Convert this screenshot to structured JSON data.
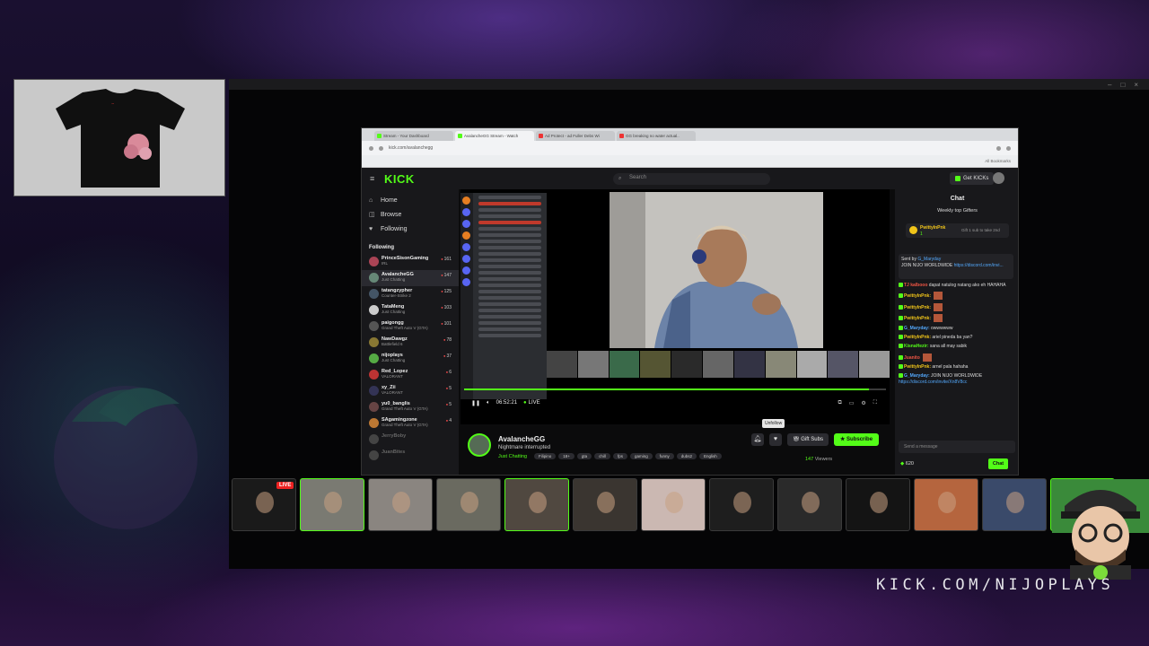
{
  "browser": {
    "tabs": [
      {
        "label": "Stream - Your Dashboard",
        "color": "#53fc18",
        "active": false
      },
      {
        "label": "AvalancheGG Stream - Watch",
        "color": "#53fc18",
        "active": true
      },
      {
        "label": "Ad Protect - ad Fuller Debs Wi",
        "color": "#e33",
        "active": false
      },
      {
        "label": "GG breaking no water actual..",
        "color": "#e33",
        "active": false
      }
    ],
    "url": "kick.com/avalanchegg",
    "bookmarks_label": "All Bookmarks"
  },
  "kick": {
    "logo": "KICK",
    "search_placeholder": "Search",
    "get_kicks": "Get KICKs",
    "nav": [
      {
        "label": "Home",
        "icon": "home-icon",
        "glyph": "⌂"
      },
      {
        "label": "Browse",
        "icon": "browse-icon",
        "glyph": "◫"
      },
      {
        "label": "Following",
        "icon": "heart-icon",
        "glyph": "♥"
      }
    ],
    "following_title": "Following",
    "channels": [
      {
        "name": "PrinceSisonGaming",
        "game": "IRL",
        "viewers": "161",
        "color": "#a45"
      },
      {
        "name": "AvalancheGG",
        "game": "Just Chatting",
        "viewers": "147",
        "color": "#687",
        "selected": true
      },
      {
        "name": "tatangzypher",
        "game": "Counter-Strike 2",
        "viewers": "125",
        "color": "#456"
      },
      {
        "name": "TataMeng",
        "game": "Just Chatting",
        "viewers": "103",
        "color": "#ccc"
      },
      {
        "name": "paigongg",
        "game": "Grand Theft Auto V (GTA)",
        "viewers": "101",
        "color": "#555"
      },
      {
        "name": "NawDawgz",
        "game": "Battlefield 6",
        "viewers": "78",
        "color": "#873"
      },
      {
        "name": "nijoplays",
        "game": "Just Chatting",
        "viewers": "37",
        "color": "#5a4"
      },
      {
        "name": "Red_Lopez",
        "game": "VALORANT",
        "viewers": "6",
        "color": "#b33"
      },
      {
        "name": "xy_Zii",
        "game": "VALORANT",
        "viewers": "5",
        "color": "#335"
      },
      {
        "name": "yu0_banglis",
        "game": "Grand Theft Auto V (GTA)",
        "viewers": "5",
        "color": "#644"
      },
      {
        "name": "SAgamingzone",
        "game": "Grand Theft Auto V (GTA)",
        "viewers": "4",
        "color": "#b73"
      },
      {
        "name": "JerryBoby",
        "game": "",
        "viewers": "",
        "color": "#444",
        "offline": true
      },
      {
        "name": "JuanBites",
        "game": "",
        "viewers": "",
        "color": "#444",
        "offline": true
      }
    ],
    "player": {
      "elapsed": "06:52:21",
      "live": "LIVE",
      "progress": 0.96
    },
    "stream": {
      "streamer": "AvalancheGG",
      "title": "Nightmare interrupted",
      "category": "Just Chatting",
      "tags": [
        "Filipino",
        "18+",
        "gta",
        "chill",
        "fps",
        "gaming",
        "funny",
        "dubs2",
        "English"
      ],
      "unfollow_tip": "Unfollow",
      "gift_subs": "Gift Subs",
      "subscribe": "Subscribe",
      "viewers": "147",
      "viewers_label": "Viewers"
    },
    "chat": {
      "title": "Chat",
      "gifters_title": "Weekly top Gifters",
      "top_gifter": "PwittyInPnk",
      "top_gifter_count": "1",
      "gift_cta": "Gift 1 sub to take 2nd",
      "pinned_by": "Sent by",
      "pinned_user": "G_Maryday",
      "pinned_text": "JOIN NIJO WORLDWIDE",
      "pinned_link": "https://discord.com/invi...",
      "messages": [
        {
          "user": "TJ kalbooo",
          "color": "#e54",
          "text": "dapat natulog natang ako eh HAHAHA"
        },
        {
          "user": "PwittyInPnk:",
          "color": "#f0c419",
          "text": "",
          "emote": true
        },
        {
          "user": "PwittyInPnk:",
          "color": "#f0c419",
          "text": "",
          "emote": true
        },
        {
          "user": "PwittyInPnk:",
          "color": "#f0c419",
          "text": "",
          "emote": true
        },
        {
          "user": "G_Maryday:",
          "color": "#53a8fc",
          "text": "owwwwww"
        },
        {
          "user": "PwittyInPnk:",
          "color": "#f0c419",
          "text": "ariel pineda ba yan?"
        },
        {
          "user": "KisnaHezir:",
          "color": "#53fc18",
          "text": "sana all may sabik"
        },
        {
          "user": "Juanito",
          "color": "#e54",
          "text": "",
          "emote": true
        },
        {
          "user": "PwittyInPnk:",
          "color": "#f0c419",
          "text": "arnel pala hahaha"
        },
        {
          "user": "G_Maryday:",
          "color": "#53a8fc",
          "text": "JOIN NIJO WORLDWIDE",
          "link": "https://discord.com/invite/Xn8V8cc"
        }
      ],
      "input_placeholder": "Send a message",
      "kicks": "620",
      "send": "Chat"
    }
  },
  "overlay": {
    "cam_live_tag": "LIVE",
    "footer_url": "KICK.COM/NIJOPLAYS",
    "cam_tiles": [
      {
        "color": "#1a1a1a",
        "lit": false
      },
      {
        "color": "#7a7a72",
        "lit": true
      },
      {
        "color": "#8a8580",
        "lit": false
      },
      {
        "color": "#6a6a60",
        "lit": false
      },
      {
        "color": "#504840",
        "lit": true
      },
      {
        "color": "#3a3530",
        "lit": false
      },
      {
        "color": "#cbb8b2",
        "lit": false
      },
      {
        "color": "#1e1e1e",
        "lit": false
      },
      {
        "color": "#2a2a2a",
        "lit": false
      },
      {
        "color": "#141414",
        "lit": false
      },
      {
        "color": "#b5653e",
        "lit": false
      },
      {
        "color": "#3a4a6a",
        "lit": false
      },
      {
        "color": "#3a8a3a",
        "lit": true
      }
    ]
  }
}
